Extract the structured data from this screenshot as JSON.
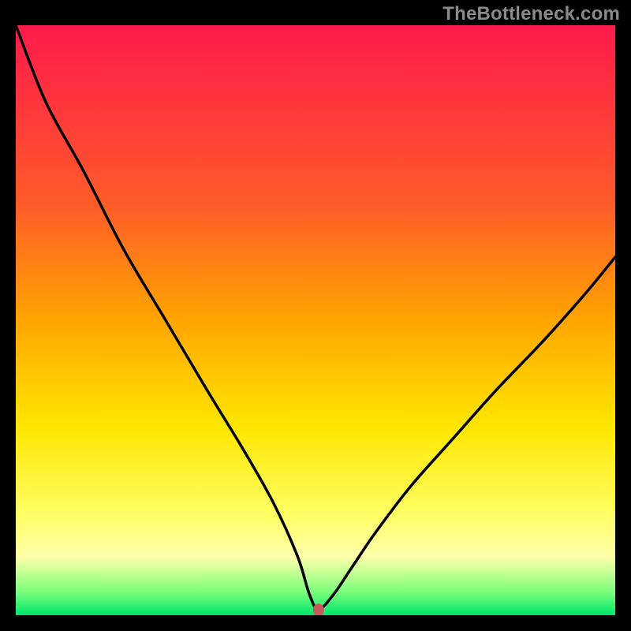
{
  "watermark": "TheBottleneck.com",
  "chart_data": {
    "type": "line",
    "title": "",
    "xlabel": "",
    "ylabel": "",
    "legend": false,
    "annotations": [],
    "gradient_background": {
      "stops": [
        {
          "offset": 0.0,
          "color": "#ff1a4b"
        },
        {
          "offset": 0.3,
          "color": "#ff5a2a"
        },
        {
          "offset": 0.5,
          "color": "#ffa500"
        },
        {
          "offset": 0.68,
          "color": "#ffe600"
        },
        {
          "offset": 0.83,
          "color": "#ffff66"
        },
        {
          "offset": 0.9,
          "color": "#ffffaa"
        },
        {
          "offset": 0.96,
          "color": "#7dff7d"
        },
        {
          "offset": 1.0,
          "color": "#00e56b"
        }
      ]
    },
    "marker": {
      "x": 0.505,
      "y": 0.991,
      "color": "#c85a5a"
    },
    "curve": {
      "description": "V-shaped curve with minimum near x≈0.5, left branch from top-left descending to bottom center, right branch rising to about y≈0.39 at x=1.0",
      "x": [
        0.0,
        0.05,
        0.113,
        0.18,
        0.25,
        0.32,
        0.38,
        0.43,
        0.47,
        0.49,
        0.505,
        0.53,
        0.56,
        0.6,
        0.66,
        0.73,
        0.8,
        0.88,
        0.95,
        1.0
      ],
      "y": [
        0.0,
        0.13,
        0.247,
        0.38,
        0.5,
        0.62,
        0.72,
        0.81,
        0.9,
        0.965,
        0.99,
        0.965,
        0.92,
        0.86,
        0.78,
        0.7,
        0.62,
        0.535,
        0.455,
        0.393
      ]
    },
    "xlim": [
      0,
      1
    ],
    "ylim": [
      0,
      1
    ]
  }
}
